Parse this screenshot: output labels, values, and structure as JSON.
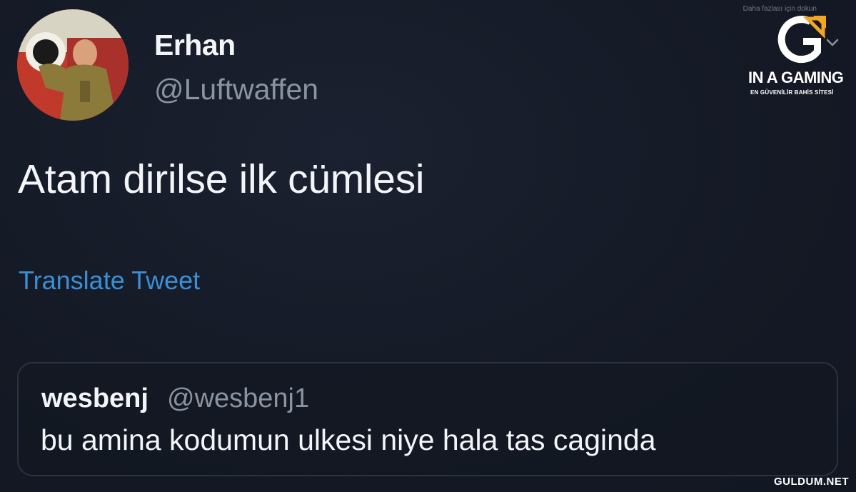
{
  "tweet": {
    "display_name": "Erhan",
    "handle": "@Luftwaffen",
    "text": "Atam dirilse ilk cümlesi",
    "translate_label": "Translate Tweet",
    "avatar_icon": "profile-avatar"
  },
  "quoted_tweet": {
    "display_name": "wesbenj",
    "handle": "@wesbenj1",
    "text": "bu amina kodumun ulkesi niye hala tas caginda"
  },
  "ad": {
    "caption": "Daha fazlası için dokun",
    "brand": "IN A GAMING",
    "tagline": "EN GÜVENİLİR BAHİS SİTESİ",
    "logo_icon": "g-logo-icon",
    "accent_color": "#f5a623"
  },
  "watermark": {
    "text": "GULDUM.NET"
  },
  "colors": {
    "background": "#151a24",
    "link": "#3a8fd6",
    "secondary_text": "#8a93a1"
  }
}
